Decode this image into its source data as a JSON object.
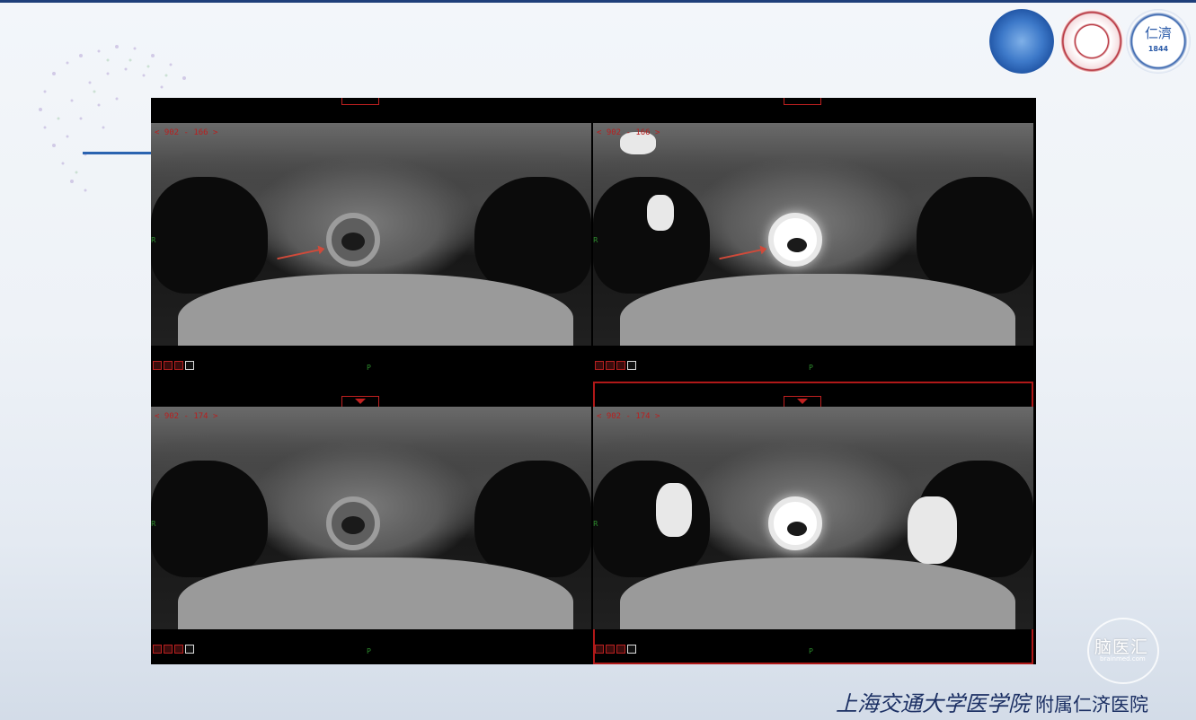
{
  "slide": {
    "colors": {
      "top_line": "#1f3f7a",
      "accent": "#2a63b0",
      "footer_text": "#1b2f63"
    }
  },
  "logos": [
    {
      "name": "school-emblem",
      "color": "#2a62b4"
    },
    {
      "name": "institute-emblem",
      "color": "#b01f2a"
    },
    {
      "name": "renji-hospital-emblem",
      "color": "#2a5aa8",
      "text": "仁濟",
      "year": "1844"
    }
  ],
  "viewer": {
    "panes": [
      {
        "id": "top-left",
        "coord": "< 902 - 166 >",
        "orientation_left": "R",
        "orientation_bottom": "P",
        "selected": false,
        "enhanced": false,
        "arrow": true
      },
      {
        "id": "top-right",
        "coord": "< 902 - 166 >",
        "orientation_left": "R",
        "orientation_bottom": "P",
        "selected": false,
        "enhanced": true,
        "arrow": true
      },
      {
        "id": "bottom-left",
        "coord": "< 902 - 174 >",
        "orientation_left": "R",
        "orientation_bottom": "P",
        "selected": false,
        "enhanced": false,
        "arrow": false
      },
      {
        "id": "bottom-right",
        "coord": "< 902 - 174 >",
        "orientation_left": "R",
        "orientation_bottom": "P",
        "selected": true,
        "enhanced": true,
        "arrow": false
      }
    ]
  },
  "watermark": {
    "name": "脑医汇",
    "sub": "brainmed.com"
  },
  "footer": {
    "school": "上海交通大学医学院",
    "hospital": "附属仁济医院"
  }
}
